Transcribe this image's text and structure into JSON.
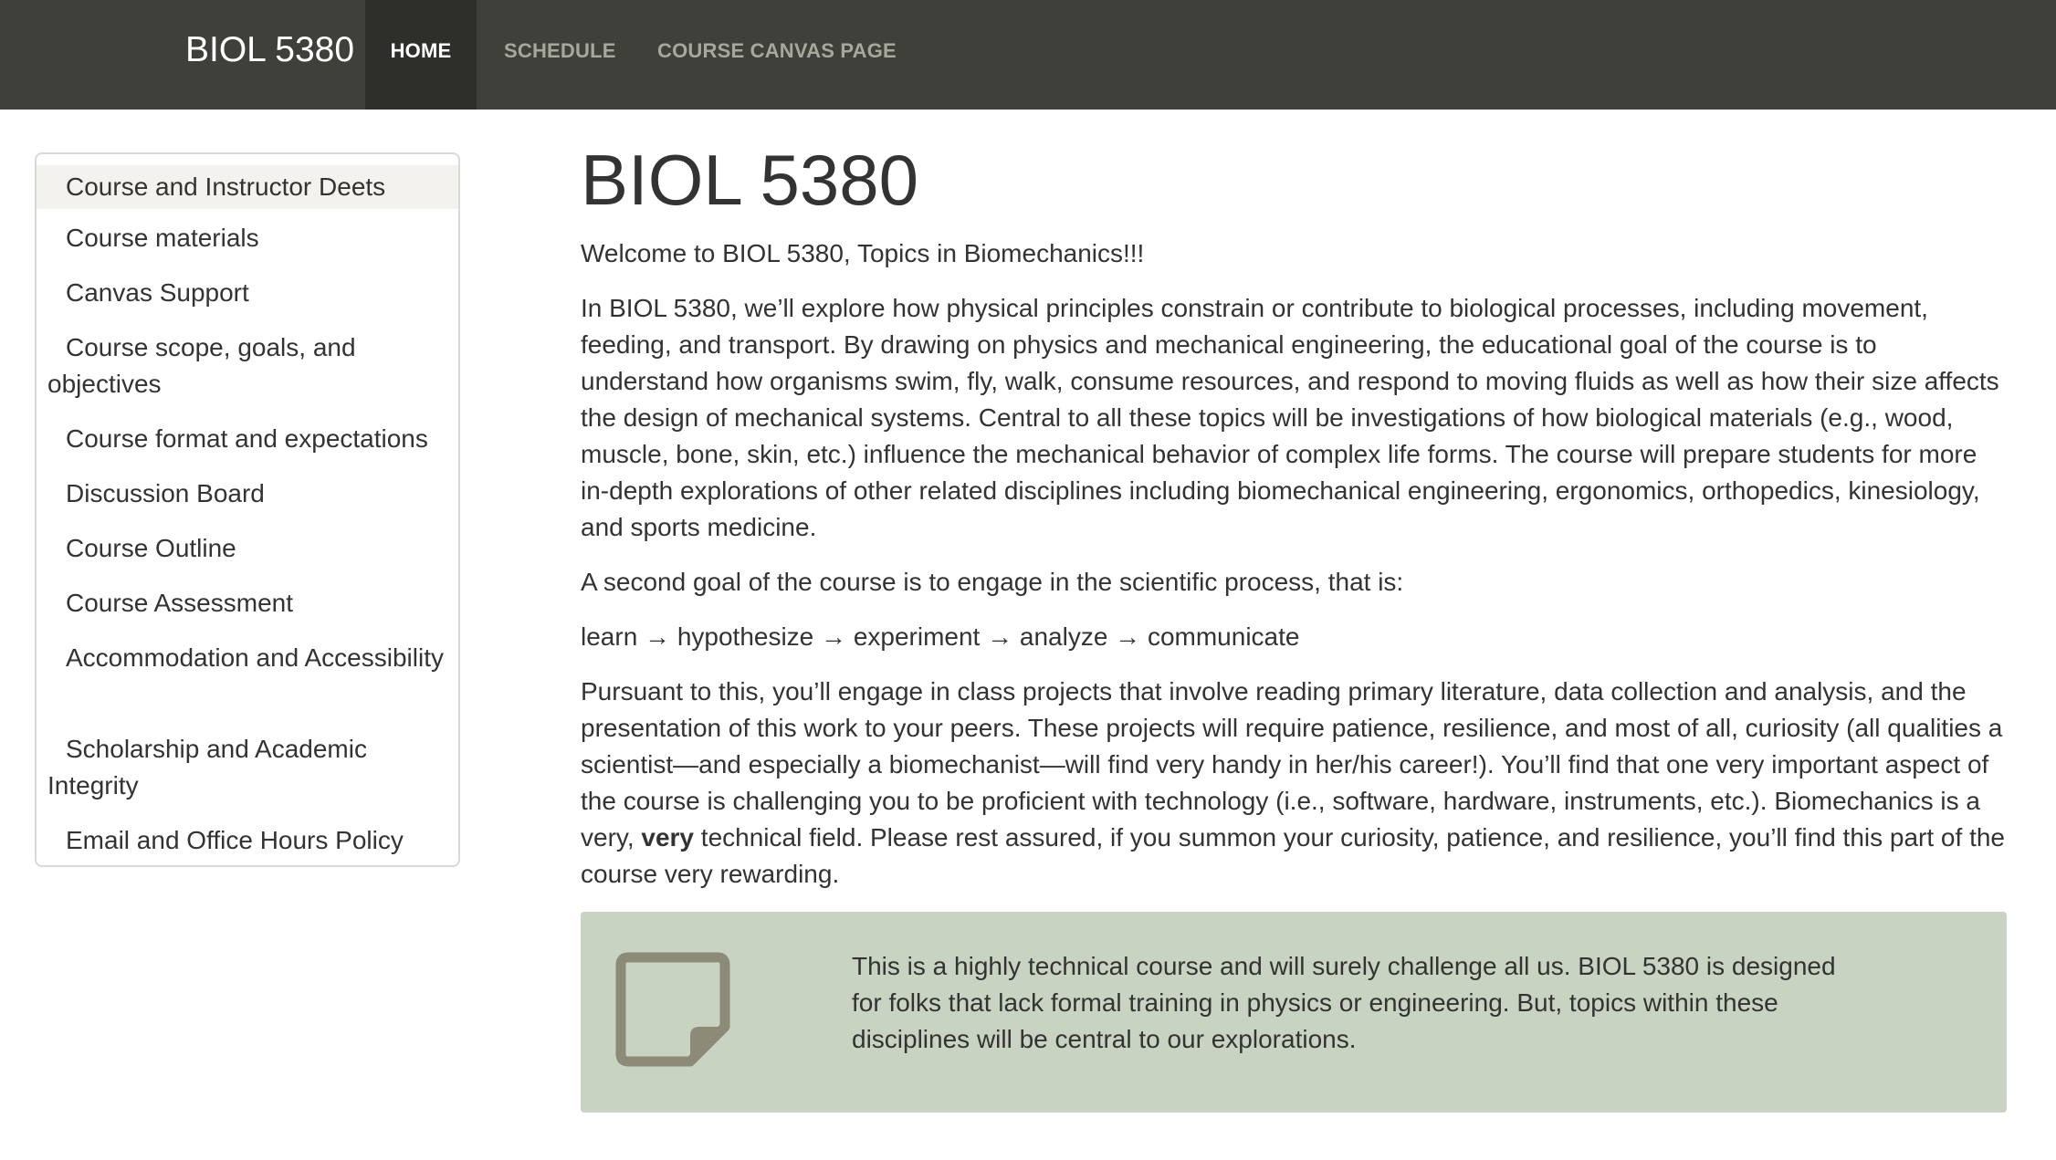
{
  "navbar": {
    "brand": "BIOL 5380",
    "items": [
      {
        "label": "HOME",
        "active": true
      },
      {
        "label": "SCHEDULE",
        "active": false
      },
      {
        "label": "COURSE CANVAS PAGE",
        "active": false
      }
    ]
  },
  "sidebar": {
    "items": [
      {
        "label": "Course and Instructor Deets",
        "active": true
      },
      {
        "label": "Course materials"
      },
      {
        "label": "Canvas Support"
      },
      {
        "label": "Course scope, goals, and objectives"
      },
      {
        "label": "Course format and expectations"
      },
      {
        "label": "Discussion Board"
      },
      {
        "label": "Course Outline"
      },
      {
        "label": "Course Assessment"
      },
      {
        "label": "Accommodation and Accessibility"
      },
      {
        "label": "Scholarship and Academic Integrity"
      },
      {
        "label": "Email and Office Hours Policy"
      }
    ]
  },
  "main": {
    "title": "BIOL 5380",
    "welcome": "Welcome to BIOL 5380, Topics in Biomechanics!!!",
    "intro": "In BIOL 5380, we’ll explore how physical principles constrain or contribute to biological processes, including movement, feeding, and transport. By drawing on physics and mechanical engineering, the educational goal of the course is to understand how organisms swim, fly, walk, consume resources, and respond to moving fluids as well as how their size affects the design of mechanical systems. Central to all these topics will be investigations of how biological materials (e.g., wood, muscle, bone, skin, etc.) influence the mechanical behavior of complex life forms. The course will prepare students for more in-depth explorations of other related disciplines including biomechanical engineering, ergonomics, orthopedics, kinesiology, and sports medicine.",
    "second_goal": "A second goal of the course is to engage in the scientific process, that is:",
    "process": "learn → hypothesize → experiment → analyze → communicate",
    "pursuant_before": "Pursuant to this, you’ll engage in class projects that involve reading primary literature, data collection and analysis, and the presentation of this work to your peers. These projects will require patience, resilience, and most of all, curiosity (all qualities a scientist—and especially a biomechanist—will find very handy in her/his career!). You’ll find that one very important aspect of the course is challenging you to be proficient with technology (i.e., software, hardware, instruments, etc.). Biomechanics is a very, ",
    "pursuant_bold": "very",
    "pursuant_after": " technical field. Please rest assured, if you summon your curiosity, patience, and resilience, you’ll find this part of the course very rewarding.",
    "callout": {
      "icon": "sticky-note-icon",
      "text": "This is a highly technical course and will surely challenge all us. BIOL 5380 is designed for folks that lack formal training in physics or engineering. But, topics within these disciplines will be central to our explorations."
    }
  },
  "colors": {
    "navbar_bg": "#3f403a",
    "nav_active_bg": "#2e2f2a",
    "nav_inactive_text": "#a7a89c",
    "callout_bg": "#c9d3c1",
    "icon_color": "#8c8b78",
    "sidebar_active_bg": "#f4f2ee"
  }
}
